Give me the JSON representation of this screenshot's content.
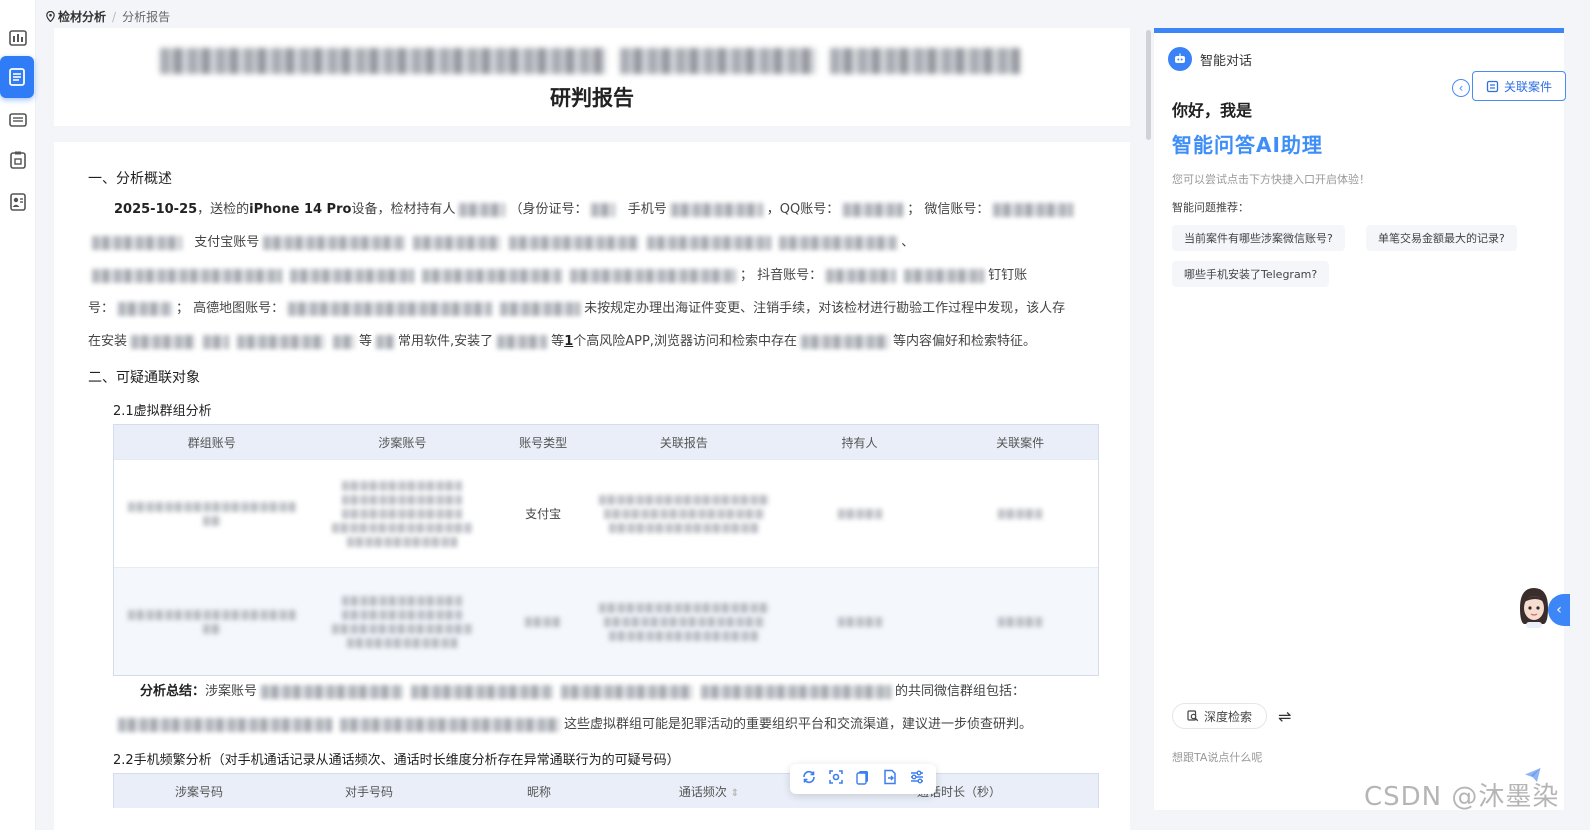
{
  "breadcrumb": {
    "root": "检材分析",
    "current": "分析报告"
  },
  "report": {
    "title": "研判报告"
  },
  "sections": {
    "overview_heading": "一、分析概述",
    "overview": {
      "date": "2025-10-25",
      "t1": "，送检的",
      "device": "iPhone 14 Pro",
      "t2": "设备，检材持有人",
      "t3": "（身份证号：",
      "t4": "手机号",
      "t5": "，QQ账号：",
      "t6": "；  微信账号：",
      "t7": "支付宝账号",
      "t8": "、",
      "t9": "；  抖音账号：",
      "t10": "钉钉账",
      "t11": "号：",
      "t12": "；  高德地图账号：",
      "t13": "未按规定办理出海证件变更、注销手续，对该检材进行勘验工作过程中发现，该人存",
      "t14": "在安装",
      "t15": "等",
      "t16": "常用软件,安装了",
      "t17": "等",
      "count": "1",
      "t18": "个高风险APP,浏览器访问和检索中存在",
      "t19": "等内容偏好和检索特征。"
    },
    "suspect_heading": "二、可疑通联对象",
    "group_heading": "2.1虚拟群组分析",
    "summary_label": "分析总结：",
    "summary_t1": "涉案账号",
    "summary_t2": "的共同微信群组包括：",
    "summary_t3": "这些虚拟群组可能是犯罪活动的重要组织平台和交流渠道，建议进一步侦查研判。",
    "phone_heading": "2.2手机频繁分析（对手机通话记录从通话频次、通话时长维度分析存在异常通联行为的可疑号码）"
  },
  "group_table": {
    "headers": [
      "群组账号",
      "涉案账号",
      "账号类型",
      "关联报告",
      "持有人",
      "关联案件"
    ],
    "rows": [
      {
        "type": "支付宝"
      },
      {
        "type": ""
      }
    ]
  },
  "phone_table": {
    "headers": [
      "涉案号码",
      "对手号码",
      "昵称",
      "通话频次",
      "通话时长（秒）"
    ],
    "sort_icon": "⇕"
  },
  "assistant": {
    "title": "智能对话",
    "link_case": "关联案件",
    "greeting": "你好，我是",
    "name": "智能问答AI助理",
    "hint": "您可以尝试点击下方快捷入口开启体验！",
    "recommend_title": "智能问题推荐：",
    "questions": [
      "当前案件有哪些涉案微信账号?",
      "单笔交易金额最大的记录?",
      "哪些手机安装了Telegram?"
    ],
    "deep_search": "深度检索",
    "placeholder": "想跟TA说点什么呢"
  },
  "watermark": "CSDN @沐墨染",
  "colors": {
    "accent": "#3d86f7",
    "table_header": "#e9eef8"
  },
  "icons": [
    "chart-icon",
    "document-icon",
    "list-icon",
    "folder-icon",
    "person-card-icon",
    "robot-icon",
    "search-icon",
    "swap-icon",
    "send-icon"
  ]
}
